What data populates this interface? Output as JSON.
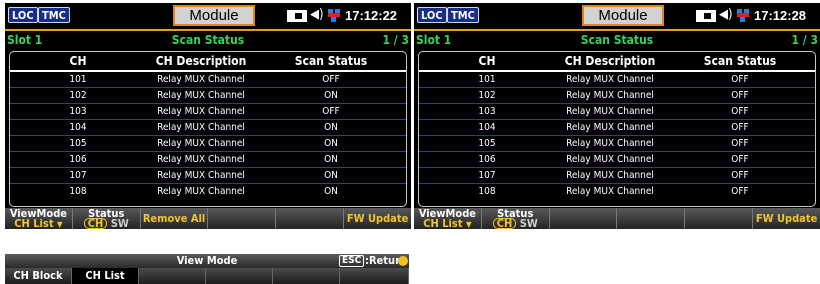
{
  "status_bar": {
    "loc": "LOC",
    "tmc": "TMC",
    "title": "Module",
    "icons": [
      "display-icon",
      "speaker-icon",
      "lan-disconnected-icon"
    ]
  },
  "screens": [
    {
      "time": "17:12:22",
      "slot": "Slot 1",
      "heading": "Scan Status",
      "page": "1 / 3",
      "columns": [
        "CH",
        "CH Description",
        "Scan Status"
      ],
      "rows": [
        {
          "ch": "101",
          "desc": "Relay MUX Channel",
          "status": "OFF"
        },
        {
          "ch": "102",
          "desc": "Relay MUX Channel",
          "status": "ON"
        },
        {
          "ch": "103",
          "desc": "Relay MUX Channel",
          "status": "OFF"
        },
        {
          "ch": "104",
          "desc": "Relay MUX Channel",
          "status": "ON"
        },
        {
          "ch": "105",
          "desc": "Relay MUX Channel",
          "status": "ON"
        },
        {
          "ch": "106",
          "desc": "Relay MUX Channel",
          "status": "ON"
        },
        {
          "ch": "107",
          "desc": "Relay MUX Channel",
          "status": "ON"
        },
        {
          "ch": "108",
          "desc": "Relay MUX Channel",
          "status": "ON"
        }
      ],
      "softkeys": {
        "viewmode_label": "ViewMode",
        "viewmode_value": "CH List",
        "status_label": "Status",
        "status_ch": "CH",
        "status_sw": "SW",
        "remove_all": "Remove All",
        "fw_update": "FW Update"
      }
    },
    {
      "time": "17:12:28",
      "slot": "Slot 1",
      "heading": "Scan Status",
      "page": "1 / 3",
      "columns": [
        "CH",
        "CH Description",
        "Scan Status"
      ],
      "rows": [
        {
          "ch": "101",
          "desc": "Relay MUX Channel",
          "status": "OFF"
        },
        {
          "ch": "102",
          "desc": "Relay MUX Channel",
          "status": "OFF"
        },
        {
          "ch": "103",
          "desc": "Relay MUX Channel",
          "status": "OFF"
        },
        {
          "ch": "104",
          "desc": "Relay MUX Channel",
          "status": "OFF"
        },
        {
          "ch": "105",
          "desc": "Relay MUX Channel",
          "status": "OFF"
        },
        {
          "ch": "106",
          "desc": "Relay MUX Channel",
          "status": "OFF"
        },
        {
          "ch": "107",
          "desc": "Relay MUX Channel",
          "status": "OFF"
        },
        {
          "ch": "108",
          "desc": "Relay MUX Channel",
          "status": "OFF"
        }
      ],
      "softkeys": {
        "viewmode_label": "ViewMode",
        "viewmode_value": "CH List",
        "status_label": "Status",
        "status_ch": "CH",
        "status_sw": "SW",
        "remove_all": "",
        "fw_update": "FW Update"
      }
    }
  ],
  "view_mode_menu": {
    "title": "View Mode",
    "esc_key": "ESC",
    "esc_label": ":Return",
    "options": [
      "CH Block",
      "CH List"
    ],
    "selected": "CH List"
  },
  "colors": {
    "accent_orange": "#e3a019",
    "slot_green": "#34d25a",
    "badge_blue": "#162d8a",
    "softkey_yellow": "#f2c52d",
    "row_divider_blue": "#233fa6"
  }
}
